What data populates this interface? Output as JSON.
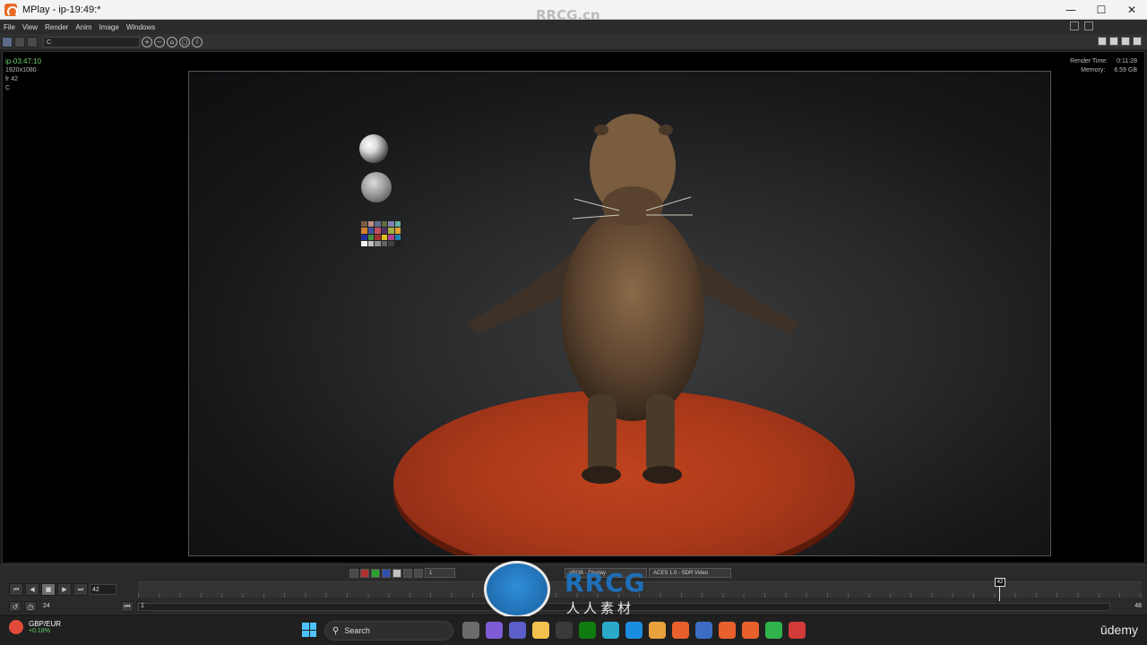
{
  "window": {
    "title": "MPlay - ip-19:49:*",
    "controls": [
      "minimize-icon",
      "maximize-icon",
      "close-icon"
    ]
  },
  "menu": [
    "File",
    "View",
    "Render",
    "Anim",
    "Image",
    "Windows"
  ],
  "toolbar": {
    "channel": "C"
  },
  "hud_left": {
    "name": "ip-03:47:10",
    "resolution": "1920x1080",
    "frame": "fr 42",
    "channel": "C"
  },
  "hud_right": {
    "render_time_label": "Render Time:",
    "render_time_value": "0:11:28",
    "memory_label": "Memory:",
    "memory_value": "6.59 GB"
  },
  "view_controls": {
    "gamma_value": "1",
    "lut_select": "sRGB - Display",
    "ocio_select": "ACES 1.0 - SDR Video"
  },
  "playbar": {
    "current_frame": "42",
    "fps": "24",
    "range_start": "1",
    "range_end": "48",
    "cursor_frame": "42"
  },
  "watermark": {
    "top_text": "RRCG.cn",
    "logo_text": "RRCG",
    "logo_sub": "人人素材"
  },
  "taskbar": {
    "ticker": "GBP/EUR",
    "ticker_change": "+0.18%",
    "search_label": "Search",
    "brand": "ūdemy"
  }
}
